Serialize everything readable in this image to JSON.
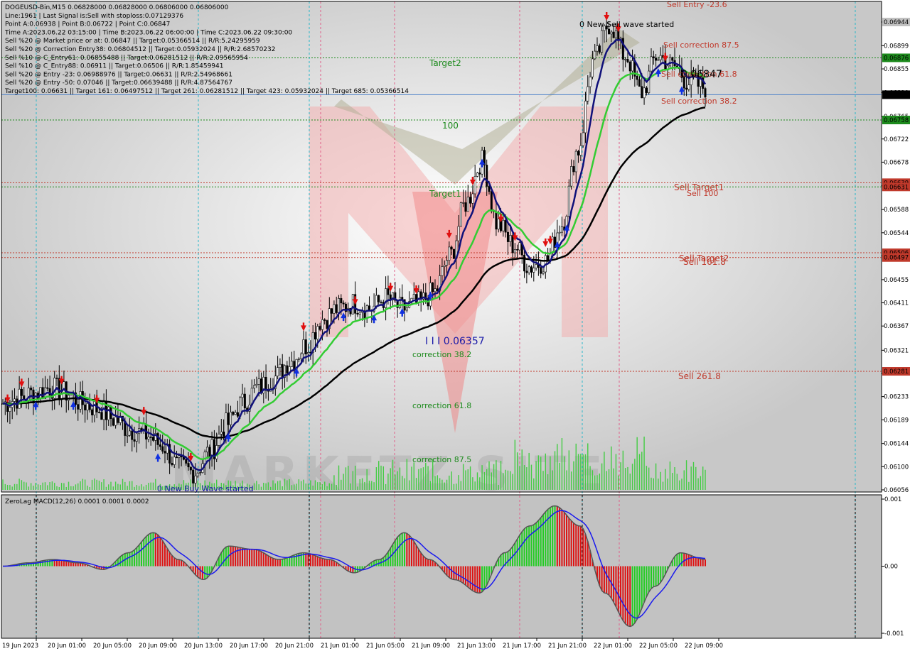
{
  "header": {
    "lines": [
      "DOGEUSD-Bin,M15  0.06828000 0.06828000 0.06806000 0.06806000",
      "Line:1961 | Last Signal is:Sell with stoploss:0.07129376",
      "Point A:0.06938 | Point B:0.06722 | Point C:0.06847",
      "Time A:2023.06.22 03:15:00 | Time B:2023.06.22 06:00:00 | Time C:2023.06.22 09:30:00",
      "Sell %20 @ Market price or at: 0.06847 || Target:0.05366514 || R/R:5.24295959",
      "Sell %20 @ Correction Entry38: 0.06804512 || Target:0.05932024 || R/R:2.68570232",
      "Sell %10 @ C_Entry61: 0.06855488 || Target:0.06281512 || R/R:2.09565954",
      "Sell %10 @ C_Entry88: 0.06911 || Target:0.06506 || R/R:1.85459941",
      "Sell %20 @ Entry -23: 0.06988976 || Target:0.06631 || R/R:2.54968661",
      "Sell %20 @ Entry -50: 0.07046 || Target:0.06639488 || R/R:4.87564767",
      "Target100: 0.06631 || Target 161: 0.06497512 || Target 261: 0.06281512 || Target 423: 0.05932024 || Target 685: 0.05366514"
    ]
  },
  "chart_data": [
    {
      "type": "candlestick",
      "symbol": "DOGEUSD-Bin",
      "timeframe": "M15",
      "ylim": [
        0.06056,
        0.06966
      ],
      "y_ticks": [
        "0.06944",
        "0.06899",
        "0.06855",
        "0.06810",
        "0.06765",
        "0.06722",
        "0.06678",
        "0.06633",
        "0.06588",
        "0.06544",
        "0.06500",
        "0.06455",
        "0.06411",
        "0.06367",
        "0.06321",
        "0.06277",
        "0.06233",
        "0.06189",
        "0.06144",
        "0.06100",
        "0.06056"
      ],
      "x_ticks": [
        "19 Jun 2023",
        "20 Jun 01:00",
        "20 Jun 05:00",
        "20 Jun 09:00",
        "20 Jun 13:00",
        "20 Jun 17:00",
        "20 Jun 21:00",
        "21 Jun 01:00",
        "21 Jun 05:00",
        "21 Jun 09:00",
        "21 Jun 13:00",
        "21 Jun 17:00",
        "21 Jun 21:00",
        "22 Jun 01:00",
        "22 Jun 05:00",
        "22 Jun 09:00"
      ],
      "close_path": [
        0.0622,
        0.0623,
        0.0624,
        0.0625,
        0.0624,
        0.0622,
        0.0621,
        0.0619,
        0.0617,
        0.0616,
        0.0614,
        0.061,
        0.0609,
        0.0613,
        0.0618,
        0.0622,
        0.0625,
        0.0627,
        0.063,
        0.0633,
        0.0638,
        0.064,
        0.0641,
        0.064,
        0.0642,
        0.064,
        0.0641,
        0.0643,
        0.065,
        0.066,
        0.0668,
        0.0656,
        0.0652,
        0.0648,
        0.0649,
        0.0656,
        0.067,
        0.0687,
        0.0694,
        0.0688,
        0.0681,
        0.0688,
        0.0686,
        0.0683,
        0.0682
      ],
      "price_tags": [
        {
          "value": "0.06944",
          "color": "#c0c0c0",
          "text_color": "#000000"
        },
        {
          "value": "0.06876",
          "color": "#1c8a1c",
          "text_color": "#ffffff"
        },
        {
          "value": "0.06806",
          "color": "#000000",
          "text_color": "#ffffff"
        },
        {
          "value": "0.06758",
          "color": "#1c8a1c",
          "text_color": "#ffffff"
        },
        {
          "value": "0.06639",
          "color": "#c0392b",
          "text_color": "#ffffff"
        },
        {
          "value": "0.06631",
          "color": "#c0392b",
          "text_color": "#ffffff"
        },
        {
          "value": "0.06506",
          "color": "#c0392b",
          "text_color": "#ffffff"
        },
        {
          "value": "0.06497",
          "color": "#c0392b",
          "text_color": "#ffffff"
        },
        {
          "value": "0.06281",
          "color": "#c0392b",
          "text_color": "#ffffff"
        }
      ],
      "levels": [
        {
          "value": 0.06876,
          "color": "#1c8a1c",
          "label": "Target2"
        },
        {
          "value": 0.06758,
          "color": "#1c8a1c",
          "label": "100"
        },
        {
          "value": 0.06639,
          "color": "#c0392b",
          "label": "Sell Target1"
        },
        {
          "value": 0.06631,
          "color": "#1c8a1c",
          "label": "Target1"
        },
        {
          "value": 0.06506,
          "color": "#c0392b",
          "label": "Sell Target2"
        },
        {
          "value": 0.06497,
          "color": "#c0392b",
          "label": "Sell 161.8"
        },
        {
          "value": 0.06281,
          "color": "#c0392b",
          "label": "Sell 261.8"
        }
      ],
      "annotations": [
        {
          "text": "Sell Entry -23.6",
          "color": "#c0392b"
        },
        {
          "text": "0 New Sell wave started",
          "color": "#000000"
        },
        {
          "text": "Sell correction 87.5",
          "color": "#c0392b"
        },
        {
          "text": "Sell correction 61.8",
          "color": "#c0392b"
        },
        {
          "text": "Sell correction 38.2",
          "color": "#c0392b"
        },
        {
          "text": "0.06847",
          "color": "#000000"
        },
        {
          "text": "Sell 100",
          "color": "#c0392b"
        },
        {
          "text": "I I I 0.06357",
          "color": "#1a1aa8"
        },
        {
          "text": "correction 38.2",
          "color": "#1c8a1c"
        },
        {
          "text": "correction 61.8",
          "color": "#1c8a1c"
        },
        {
          "text": "correction 87.5",
          "color": "#1c8a1c"
        },
        {
          "text": "0 New Buy Wave started",
          "color": "#1a1aa8"
        }
      ],
      "watermark": "MARKETZ SITE"
    },
    {
      "type": "bar",
      "title": "ZeroLag MACD(12,26) 0.0001 0.0001 0.0002",
      "ylim": [
        -0.001,
        0.001
      ],
      "y_ticks": [
        "0.001",
        "0.00",
        "-0.001"
      ],
      "histogram_profile": [
        0.0,
        5e-05,
        0.0001,
        5e-05,
        -5e-05,
        0.0002,
        0.0005,
        0.0001,
        -0.0002,
        0.0003,
        0.00025,
        0.0001,
        0.0002,
        0.0001,
        -0.0001,
        0.0001,
        0.0005,
        0.0001,
        -0.0002,
        -0.0004,
        0.0002,
        0.0006,
        0.0009,
        0.0006,
        -0.0004,
        -0.0009,
        -0.0003,
        0.0002,
        0.0001
      ],
      "colors": {
        "positive_rising": "#22cc22",
        "falling": "#dd1111",
        "signal": "#1a1aee",
        "macd": "#555555"
      }
    }
  ]
}
